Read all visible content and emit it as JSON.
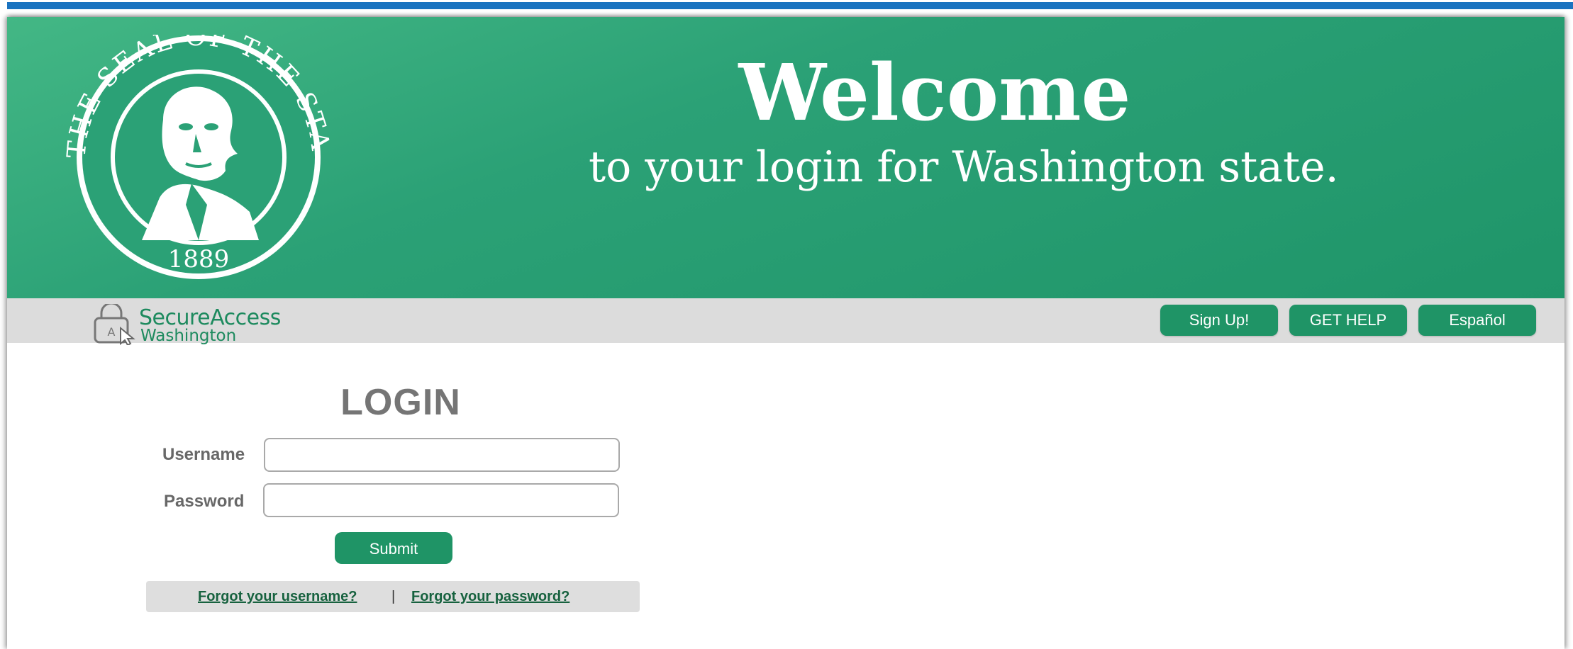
{
  "banner": {
    "seal_text_top": "THE SEAL OF THE STATE OF WASHINGTON",
    "seal_year": "1889",
    "welcome_title": "Welcome",
    "welcome_subtitle": "to your login for Washington state."
  },
  "brand": {
    "name_line1": "SecureAccess",
    "name_line2": "Washington"
  },
  "nav": {
    "signup_label": "Sign Up!",
    "help_label": "GET HELP",
    "espanol_label": "Español"
  },
  "login": {
    "title": "LOGIN",
    "username_label": "Username",
    "username_value": "",
    "password_label": "Password",
    "password_value": "",
    "submit_label": "Submit",
    "forgot_username": "Forgot your username?",
    "separator": "|",
    "forgot_password": "Forgot your password?"
  },
  "colors": {
    "banner_green": "#2ba176",
    "button_green": "#1f9466",
    "top_line_blue": "#1a73c0",
    "nav_gray": "#dcdcdc"
  }
}
